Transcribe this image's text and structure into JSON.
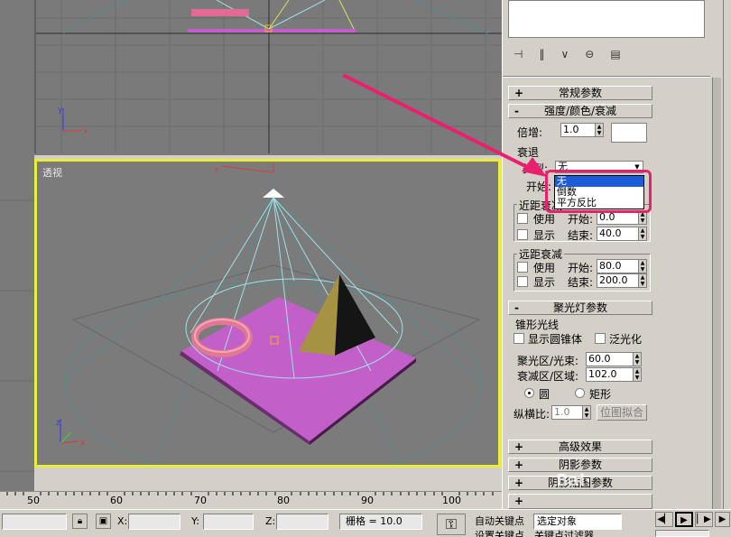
{
  "viewport": {
    "perspective_label": "透视",
    "axis_x": "x",
    "axis_y": "y",
    "axis_z": "z"
  },
  "ruler": {
    "ticks": [
      "50",
      "60",
      "70",
      "80",
      "90",
      "100"
    ]
  },
  "status": {
    "x_label": "X:",
    "y_label": "Y:",
    "z_label": "Z:",
    "grid_text": "栅格 = 10.0",
    "auto_key": "自动关键点",
    "selected_object": "选定对象",
    "set_key_partial": "设置关键点",
    "filter_partial": "关键点过滤器..."
  },
  "panel": {
    "rollout_general": "常规参数",
    "rollout_intensity": "强度/颜色/衰减",
    "multiplier_label": "倍增:",
    "multiplier_value": "1.0",
    "decay_group": "衰退",
    "type_label": "类型:",
    "type_value": "无",
    "start_label": "开始:",
    "dropdown_options": [
      "无",
      "倒数",
      "平方反比"
    ],
    "near_group": "近距衰减",
    "near_use": "使用",
    "near_show": "显示",
    "near_start_label": "开始:",
    "near_start_value": "0.0",
    "near_end_label": "结束:",
    "near_end_value": "40.0",
    "far_group": "远距衰减",
    "far_use": "使用",
    "far_show": "显示",
    "far_start_label": "开始:",
    "far_start_value": "80.0",
    "far_end_label": "结束:",
    "far_end_value": "200.0",
    "rollout_spot": "聚光灯参数",
    "cone_group": "锥形光线",
    "show_cone": "显示圆锥体",
    "overshoot": "泛光化",
    "hotspot_label": "聚光区/光束:",
    "hotspot_value": "60.0",
    "falloff_label": "衰减区/区域:",
    "falloff_value": "102.0",
    "circle": "圆",
    "rectangle": "矩形",
    "aspect_label": "纵横比:",
    "aspect_value": "1.0",
    "bitmap_fit": "位图拟合",
    "rollout_advanced": "高级效果",
    "rollout_shadow": "阴影参数",
    "rollout_shadow_map_partial": "阴影贴图参数"
  },
  "colors": {
    "viewport_bg": "#7b7b7b",
    "active_border": "#ecec3a",
    "highlight": "#e8206e",
    "plane": "#c35fc9",
    "torus": "#e07892",
    "pyramid": "#8c7c3a"
  }
}
